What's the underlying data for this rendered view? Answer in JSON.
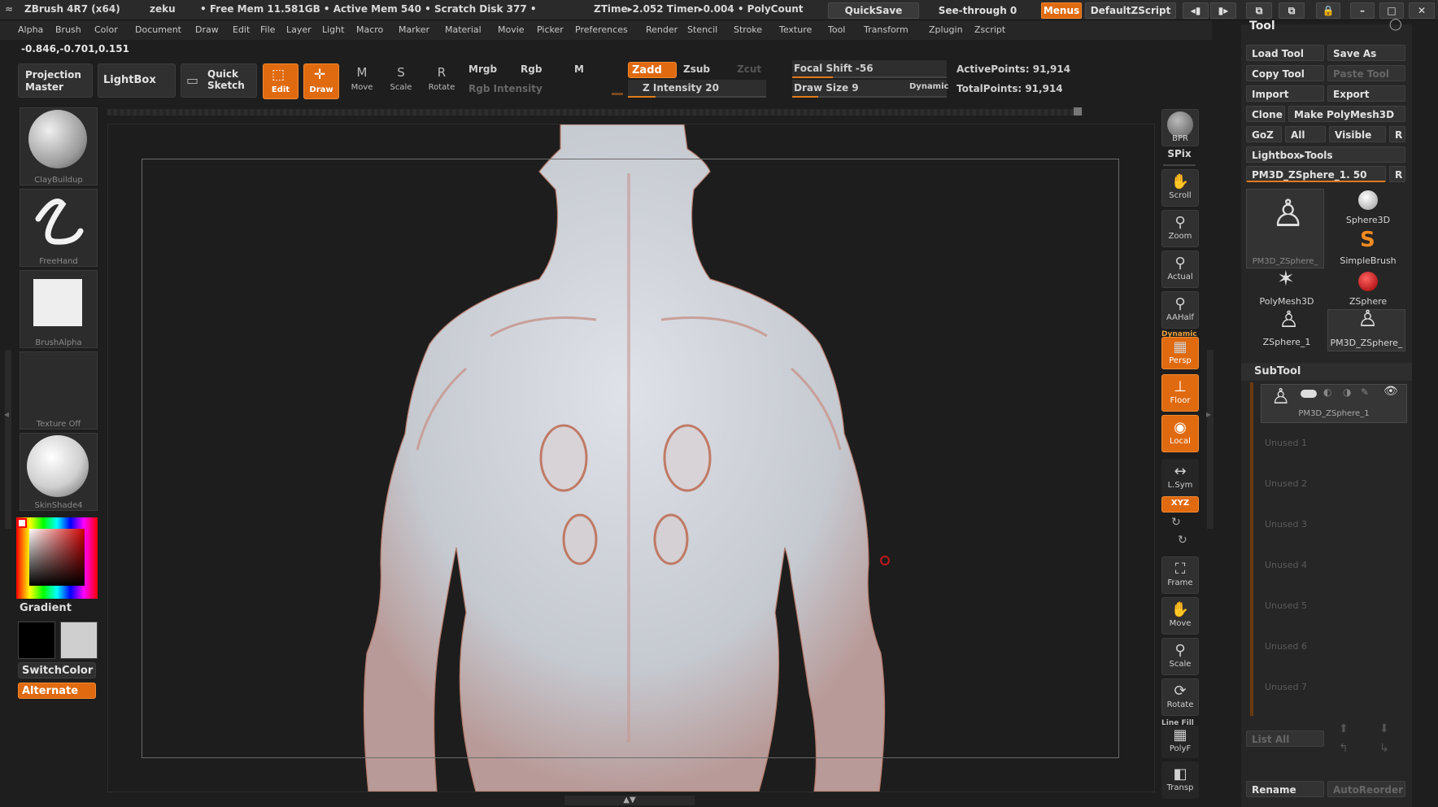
{
  "titlebar": {
    "app": "ZBrush 4R7 (x64)",
    "user": "zeku",
    "stats": "• Free Mem 11.581GB • Active Mem 540 • Scratch Disk 377 •",
    "ztime": "ZTime▸2.052  Timer▸0.004 • PolyCount",
    "quicksave": "QuickSave",
    "seethrough": "See-through  0",
    "menus": "Menus",
    "defaultzscript": "DefaultZScript"
  },
  "menubar": [
    "Alpha",
    "Brush",
    "Color",
    "Document",
    "Draw",
    "Edit",
    "File",
    "Layer",
    "Light",
    "Macro",
    "Marker",
    "Material",
    "Movie",
    "Picker",
    "Preferences",
    "Render",
    "Stencil",
    "Stroke",
    "Texture",
    "Tool",
    "Transform",
    "Zplugin",
    "Zscript"
  ],
  "coords": "-0.846,-0.701,0.151",
  "toolbar": {
    "projection_master": "Projection\nMaster",
    "lightbox": "LightBox",
    "quick_sketch": "Quick\nSketch",
    "edit": "Edit",
    "draw": "Draw",
    "move": "Move",
    "scale": "Scale",
    "rotate": "Rotate",
    "mrgb": "Mrgb",
    "rgb": "Rgb",
    "m": "M",
    "rgb_intensity": "Rgb Intensity",
    "zadd": "Zadd",
    "zsub": "Zsub",
    "zcut": "Zcut",
    "z_intensity": "Z Intensity 20",
    "z_intensity_level": 0.2,
    "focal_shift": "Focal Shift -56",
    "draw_size": "Draw Size 9",
    "dynamic": "Dynamic",
    "active_points": "ActivePoints: 91,914",
    "total_points": "TotalPoints: 91,914"
  },
  "left_panel": {
    "brush1": "ClayBuildup",
    "brush2": "FreeHand",
    "alpha": "BrushAlpha",
    "texture": "Texture Off",
    "material": "SkinShade4",
    "gradient": "Gradient",
    "switchcolor": "SwitchColor",
    "alternate": "Alternate"
  },
  "right_shelf": [
    {
      "label": "BPR",
      "icon": "sphere-icon"
    },
    {
      "label": "SPix",
      "icon": "slider-icon"
    },
    {
      "label": "Scroll",
      "icon": "hand-icon"
    },
    {
      "label": "Zoom",
      "icon": "magnifier-icon"
    },
    {
      "label": "Actual",
      "icon": "magnifier-icon"
    },
    {
      "label": "AAHalf",
      "icon": "magnifier-icon"
    },
    {
      "label": "Persp",
      "icon": "grid-icon"
    },
    {
      "label": "Floor",
      "icon": "floor-icon"
    },
    {
      "label": "Local",
      "icon": "local-icon"
    },
    {
      "label": "L.Sym",
      "icon": "arrows-icon"
    },
    {
      "label": "XYZ",
      "icon": "xyz-icon"
    },
    {
      "label": "Frame",
      "icon": "frame-icon"
    },
    {
      "label": "Move",
      "icon": "hand-icon"
    },
    {
      "label": "Scale",
      "icon": "magnifier-icon"
    },
    {
      "label": "Rotate",
      "icon": "rotate-icon"
    },
    {
      "label": "PolyF",
      "icon": "polyframe-icon"
    },
    {
      "label": "Transp",
      "icon": "transp-icon"
    }
  ],
  "shelf_extra": {
    "dynamic": "Dynamic",
    "line_fill": "Line Fill"
  },
  "palette": {
    "title": "Tool",
    "load_tool": "Load Tool",
    "save_as": "Save As",
    "copy_tool": "Copy Tool",
    "paste_tool": "Paste Tool",
    "import": "Import",
    "export": "Export",
    "clone": "Clone",
    "make_polymesh": "Make PolyMesh3D",
    "goz": "GoZ",
    "all": "All",
    "visible": "Visible",
    "r": "R",
    "lightbox_tools": "Lightbox▸Tools",
    "current_tool": "PM3D_ZSphere_1. 50",
    "tools": [
      "PM3D_ZSphere_",
      "Sphere3D",
      "SimpleBrush",
      "PolyMesh3D",
      "ZSphere",
      "ZSphere_1",
      "PM3D_ZSphere_"
    ],
    "subtool_title": "SubTool",
    "subtool_active": "PM3D_ZSphere_1",
    "unused": [
      "Unused 1",
      "Unused 2",
      "Unused 3",
      "Unused 4",
      "Unused 5",
      "Unused 6",
      "Unused 7"
    ],
    "list_all": "List  All",
    "rename": "Rename",
    "autoreorder": "AutoReorder"
  },
  "colors": {
    "accent": "#e06a10",
    "background": "#1e1e1e",
    "panel": "#262626"
  }
}
